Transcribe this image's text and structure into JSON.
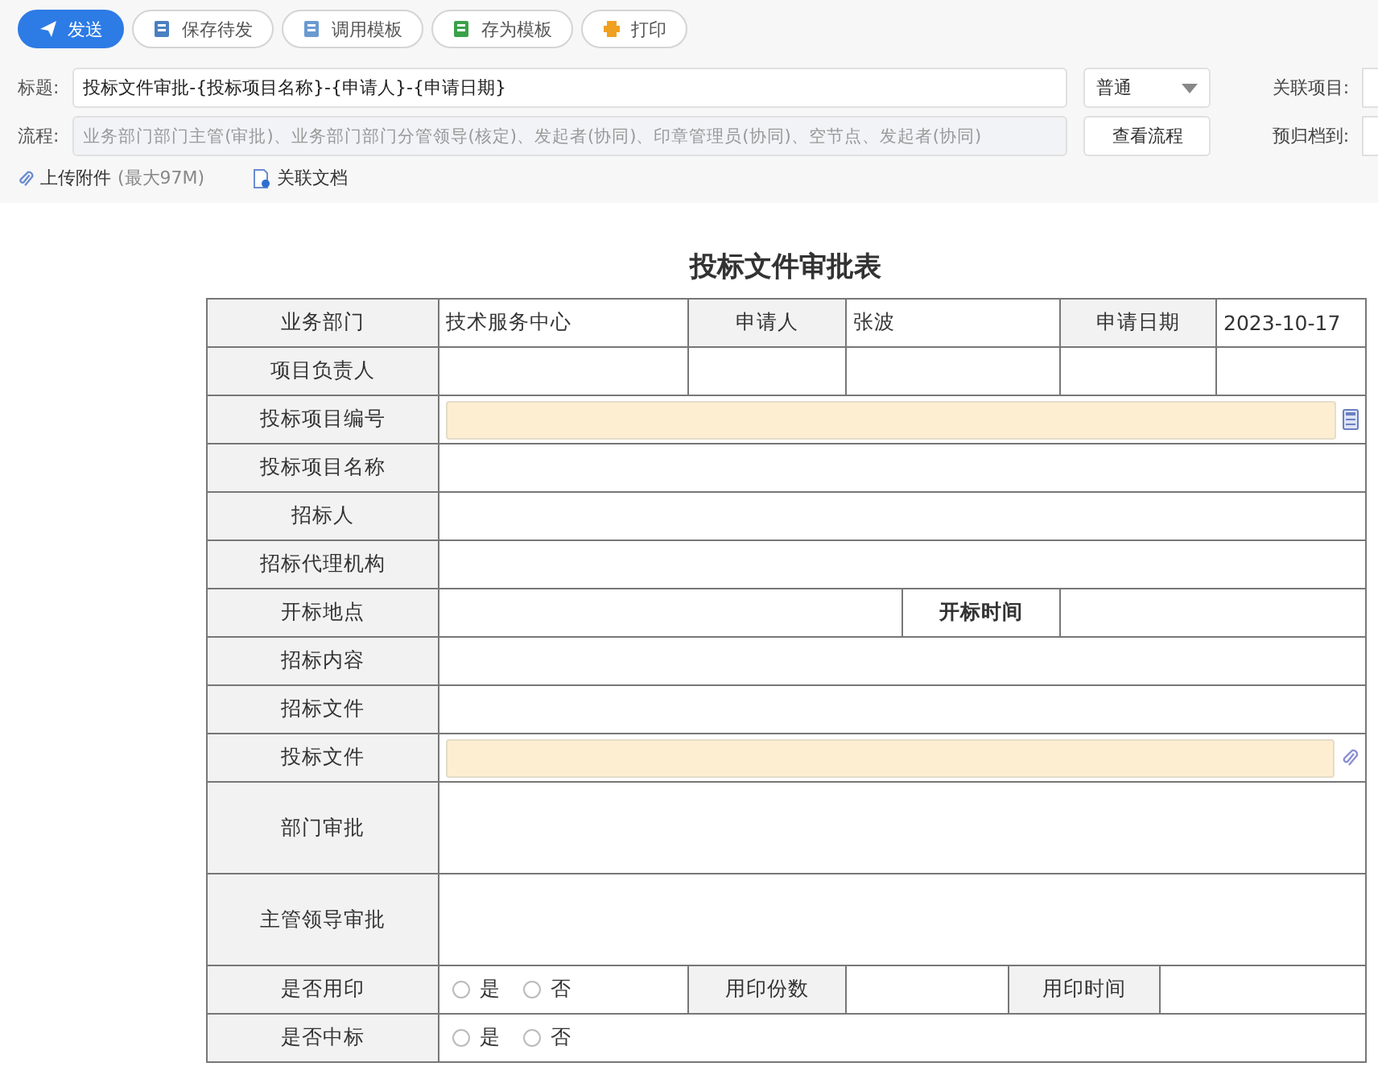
{
  "toolbar": [
    {
      "label": "发送",
      "kind": "primary"
    },
    {
      "label": "保存待发",
      "kind": "default"
    },
    {
      "label": "调用模板",
      "kind": "default"
    },
    {
      "label": "存为模板",
      "kind": "default"
    },
    {
      "label": "打印",
      "kind": "default"
    }
  ],
  "title_field": {
    "label": "标题:",
    "value": "投标文件审批-{投标项目名称}-{申请人}-{申请日期}"
  },
  "priority": {
    "value": "普通"
  },
  "related_project": {
    "label": "关联项目:"
  },
  "flow_field": {
    "label": "流程:",
    "placeholder": "业务部门部门主管(审批)、业务部门部门分管领导(核定)、发起者(协同)、印章管理员(协同)、空节点、发起者(协同)"
  },
  "view_flow_button": "查看流程",
  "archive": {
    "label": "预归档到:"
  },
  "attachments": [
    {
      "label": "上传附件",
      "note": "(最大97M)"
    },
    {
      "label": "关联文档"
    }
  ],
  "form": {
    "title": "投标文件审批表",
    "rows": [
      {
        "kind": "header6",
        "cells": [
          "业务部门",
          "技术服务中心",
          "申请人",
          "张波",
          "申请日期",
          "2023-10-17"
        ]
      },
      {
        "kind": "header6",
        "cells": [
          "项目负责人",
          "",
          "",
          "",
          "",
          ""
        ]
      },
      {
        "kind": "number_field",
        "cells": [
          "投标项目编号"
        ]
      },
      {
        "kind": "wide",
        "cells": [
          "投标项目名称"
        ]
      },
      {
        "kind": "wide",
        "cells": [
          "招标人"
        ]
      },
      {
        "kind": "wide",
        "cells": [
          "招标代理机构"
        ]
      },
      {
        "kind": "pair",
        "cells": [
          "开标地点",
          "",
          "",
          "开标时间",
          ""
        ]
      },
      {
        "kind": "wide",
        "cells": [
          "招标内容"
        ]
      },
      {
        "kind": "wide",
        "cells": [
          "招标文件"
        ]
      },
      {
        "kind": "file_field",
        "cells": [
          "投标文件"
        ]
      },
      {
        "kind": "tall",
        "cells": [
          "部门审批"
        ]
      },
      {
        "kind": "tall",
        "cells": [
          "主管领导审批"
        ]
      },
      {
        "kind": "seal",
        "cells": [
          "是否用印",
          "",
          "用印份数",
          "",
          "用印时间",
          ""
        ],
        "options": [
          {
            "label": "是",
            "selected": false
          },
          {
            "label": "否",
            "selected": false
          }
        ]
      },
      {
        "kind": "radio",
        "cells": [
          "是否中标"
        ],
        "options": [
          {
            "label": "是",
            "selected": false
          },
          {
            "label": "否",
            "selected": false
          }
        ]
      }
    ]
  }
}
